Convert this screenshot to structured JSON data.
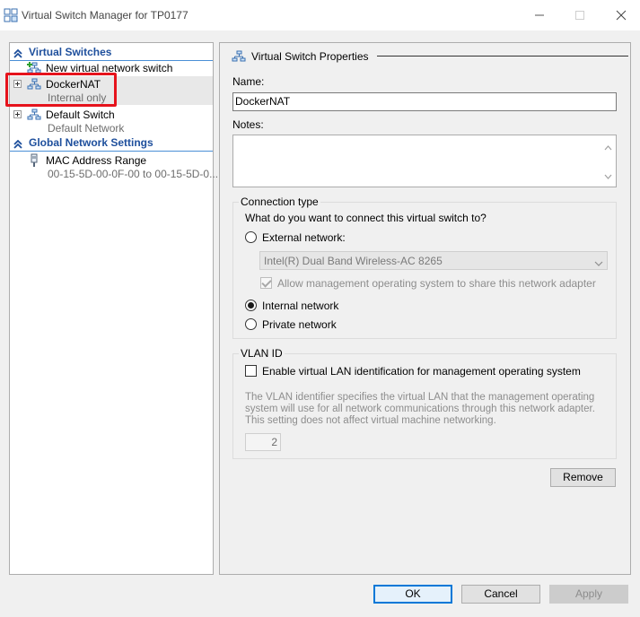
{
  "window": {
    "title": "Virtual Switch Manager for TP0177"
  },
  "tree": {
    "section_switches": "Virtual Switches",
    "new_switch": "New virtual network switch",
    "switches": [
      {
        "name": "DockerNAT",
        "subtitle": "Internal only"
      },
      {
        "name": "Default Switch",
        "subtitle": "Default Network"
      }
    ],
    "section_global": "Global Network Settings",
    "mac_range": {
      "name": "MAC Address Range",
      "subtitle": "00-15-5D-00-0F-00 to 00-15-5D-0..."
    }
  },
  "properties": {
    "header": "Virtual Switch Properties",
    "name_label": "Name:",
    "name_value": "DockerNAT",
    "notes_label": "Notes:",
    "notes_value": "",
    "connection": {
      "title": "Connection type",
      "question": "What do you want to connect this virtual switch to?",
      "external_label": "External network:",
      "adapter_value": "Intel(R) Dual Band Wireless-AC 8265",
      "allow_mgmt_label": "Allow management operating system to share this network adapter",
      "internal_label": "Internal network",
      "private_label": "Private network",
      "selected": "internal"
    },
    "vlan": {
      "title": "VLAN ID",
      "enable_label": "Enable virtual LAN identification for management operating system",
      "description": "The VLAN identifier specifies the virtual LAN that the management operating system will use for all network communications through this network adapter. This setting does not affect virtual machine networking.",
      "id_value": "2"
    },
    "remove_label": "Remove"
  },
  "footer": {
    "ok_label": "OK",
    "cancel_label": "Cancel",
    "apply_label": "Apply"
  },
  "colors": {
    "section_header": "#1e4f9c",
    "highlight": "#e6131c",
    "default_button_border": "#0078d7"
  }
}
